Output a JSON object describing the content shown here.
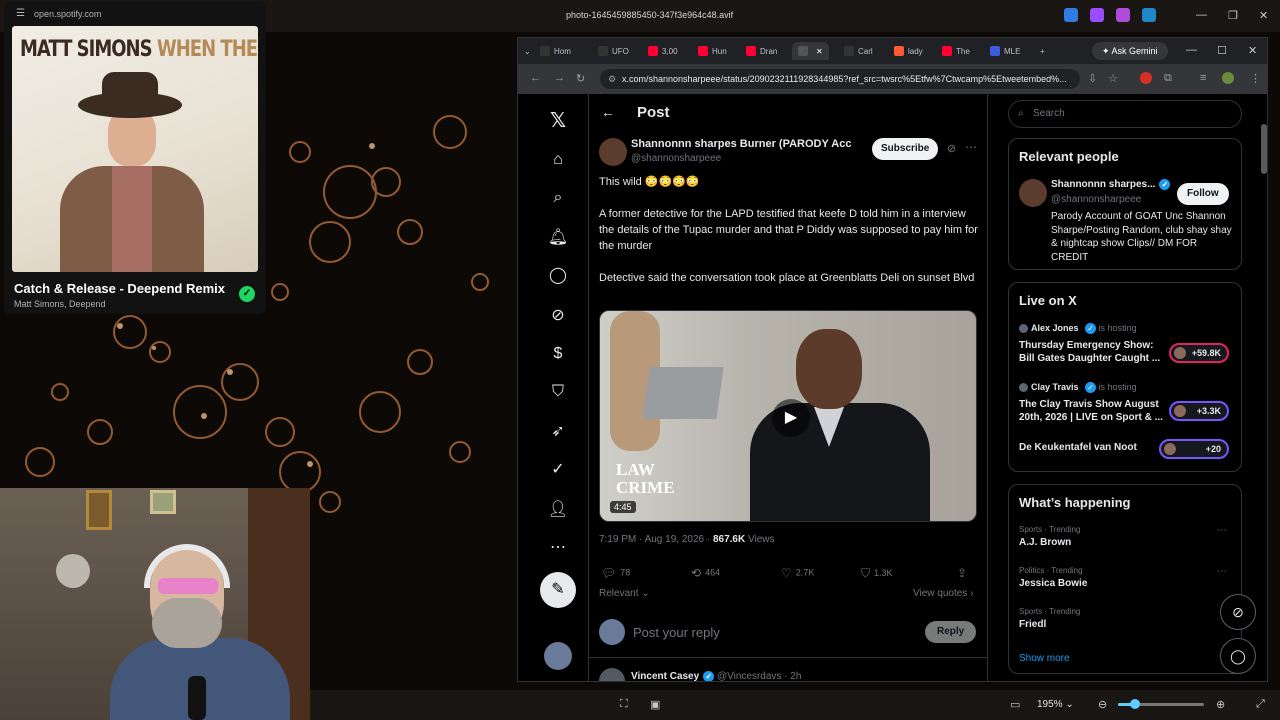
{
  "viewer": {
    "file_title": "photo-1645459885450-347f3e964c48.avif",
    "zoom_label": "195%",
    "zoom_fraction": 0.2
  },
  "spotify": {
    "url": "open.spotify.com",
    "album_artist_text": "MATT SIMONS",
    "album_title_text": "WHEN THE LIGHTS GO DOWN",
    "track": "Catch & Release - Deepend Remix",
    "artists": "Matt Simons, Deepend",
    "saved_icon": "check-circle-icon",
    "accent": "#1ed760"
  },
  "browser": {
    "tabs": [
      {
        "label": "Hom",
        "icon_color": "#ffffff"
      },
      {
        "label": "UFO",
        "icon_color": "#ffffff"
      },
      {
        "label": "3,00",
        "icon_color": "#ff0033"
      },
      {
        "label": "Hun",
        "icon_color": "#ff0033"
      },
      {
        "label": "Dran",
        "icon_color": "#ff0033"
      },
      {
        "label": "",
        "icon_color": "#ffffff"
      },
      {
        "label": "Carl",
        "icon_color": "#ffffff"
      },
      {
        "label": "lady",
        "icon_color": "#ff5a36"
      },
      {
        "label": "The",
        "icon_color": "#ff0033"
      },
      {
        "label": "MLE",
        "icon_color": "#3b5bdb"
      }
    ],
    "gemini_label": "Ask Gemini",
    "url": "x.com/shannonsharpeee/status/2090232111928344985?ref_src=twsrc%5Etfw%7Ctwcamp%5Etweetembed%..."
  },
  "x": {
    "header_title": "Post",
    "author_name": "Shannonnn sharpes Burner (PARODY Accou...",
    "author_handle": "@shannonsharpeee",
    "subscribe_label": "Subscribe",
    "text_line1": "This wild 😳😳😳😳",
    "text_para2": "A former detective for the LAPD testified that keefe D told him in a interview the details of the Tupac murder and that P Diddy was supposed to pay him for the murder",
    "text_para3": "Detective said the conversation took place at Greenblatts Deli on sunset Blvd",
    "video_logo_1": "LAW",
    "video_logo_2": "CRIME",
    "video_duration": "4:45",
    "timestamp": "7:19 PM · Aug 19, 2026 · ",
    "views_count": "867.6K",
    "views_label": " Views",
    "replies": "78",
    "reposts": "464",
    "likes": "2.7K",
    "bookmarks": "1.3K",
    "relevant_label": "Relevant",
    "view_quotes_label": "View quotes",
    "reply_placeholder": "Post your reply",
    "reply_button": "Reply",
    "next_reply_name": "Vincent Casey",
    "next_reply_handle": "@Vincesrdavs · 2h",
    "search_placeholder": "Search",
    "relevant_people": {
      "heading": "Relevant people",
      "name": "Shannonnn sharpes...",
      "handle": "@shannonsharpeee",
      "follow_label": "Follow",
      "bio": "Parody Account of GOAT Unc Shannon Sharpe/Posting Random, club shay shay & nightcap show Clips// DM FOR CREDIT"
    },
    "live": {
      "heading": "Live on X",
      "hosting_label": "is hosting",
      "items": [
        {
          "host": "Alex Jones",
          "title": "Thursday Emergency Show: Bill Gates Daughter Caught ...",
          "count": "+59.8K"
        },
        {
          "host": "Clay Travis",
          "title": "The Clay Travis Show August 20th, 2026 | LIVE on Sport & ...",
          "count": "+3.3K"
        },
        {
          "host": "",
          "title": "De Keukentafel van Noot",
          "count": "+20"
        }
      ]
    },
    "happening": {
      "heading": "What’s happening",
      "items": [
        {
          "category": "Sports · Trending",
          "topic": "A.J. Brown"
        },
        {
          "category": "Politics · Trending",
          "topic": "Jessica Bowie"
        },
        {
          "category": "Sports · Trending",
          "topic": "Friedl"
        }
      ],
      "show_more": "Show more"
    }
  }
}
